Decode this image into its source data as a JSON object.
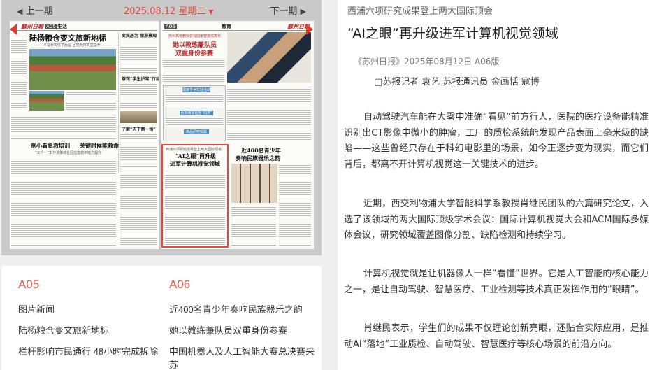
{
  "nav": {
    "prev_arrow": "◀",
    "prev_label": "上一期",
    "date": "2025.08.12 星期二",
    "date_caret": "▼",
    "next_label": "下一期",
    "next_arrow": "▶"
  },
  "newspaper": {
    "page_a": {
      "masthead": "蘇州日報",
      "section_code": "A05",
      "section_name": "生活",
      "headline": "陆杨粮仓变文旅新地标",
      "headline_sub": "不是长得好了而是 土地利用效益提升",
      "side_headline_1": "变民居为 旅游景观",
      "side_headline_2": "茶馆“学生护驾”行动",
      "side_headline_3": "了解“天下第一桥”",
      "bottom_headline_1": "别小看急救培训",
      "bottom_headline_2": "关键时候能救命",
      "bottom_sub": "“三个一”工作法推动社区应急救护能力提升"
    },
    "page_b": {
      "masthead": "蘇州日報",
      "section_code": "A06",
      "section_name": "教育",
      "top_kicker": "苏州高校教师获得国家智慧优秀奖",
      "headline_1": "她以教练兼队员",
      "headline_2": "双重身份参赛",
      "mid_bar_1": "国家学术实践活动",
      "mid_bar_2": "创新赛道首批“同类”",
      "mid_bar_3": "精品研究实践",
      "highlight_kicker": "西浦六项研究成果登上两大国际顶会",
      "highlight_headline_1": "“AI之眼”再升级",
      "highlight_headline_2": "进军计算机视觉领域",
      "right_headline_1": "近400名青少年",
      "right_headline_2": "奏响民族器乐之韵"
    }
  },
  "index": {
    "columns": [
      {
        "code": "A05",
        "items": [
          "图片新闻",
          "陆杨粮仓变文旅新地标",
          "栏杆影响市民通行 48小时完成拆除"
        ]
      },
      {
        "code": "A06",
        "items": [
          "近400名青少年奏响民族器乐之韵",
          "她以教练兼队员双重身份参赛",
          "中国机器人及人工智能大赛总决赛来苏"
        ]
      }
    ]
  },
  "article": {
    "kicker": "西浦六项研究成果登上两大国际顶会",
    "title": "“AI之眼”再升级进军计算机视觉领域",
    "source": "《苏州日报》2025年08月12日 A06版",
    "byline": "□苏报记者 袁艺 苏报通讯员 金画恬 寇博",
    "paragraphs": [
      "自动驾驶汽车能在大雾中准确“看见”前方行人，医院的医疗设备能精准识别出CT影像中微小的肿瘤，工厂的质检系统能发现产品表面上毫米级的缺陷——这些曾经只存在于科幻电影里的场景，如今正逐步变为现实，而它们背后，都离不开计算机视觉这一关键技术的进步。",
      "近期，西交利物浦大学智能科学系教授肖继民团队的六篇研究论文，入选了该领域的两大国际顶级学术会议：国际计算机视觉大会和ACM国际多媒体会议，研究领域覆盖图像分割、缺陷检测和持续学习。",
      "计算机视觉就是让机器像人一样“看懂”世界。它是人工智能的核心能力之一，是让自动驾驶、智慧医疗、工业检测等技术真正发挥作用的“眼睛”。",
      "肖继民表示，学生们的成果不仅理论创新亮眼，还贴合实际应用，是推动AI“落地”工业质检、自动驾驶、智慧医疗等核心场景的前沿方向。"
    ]
  },
  "colors": {
    "accent_red": "#e0493a",
    "highlight_border": "#e8493f",
    "panel_gray": "#c9c9c9"
  }
}
